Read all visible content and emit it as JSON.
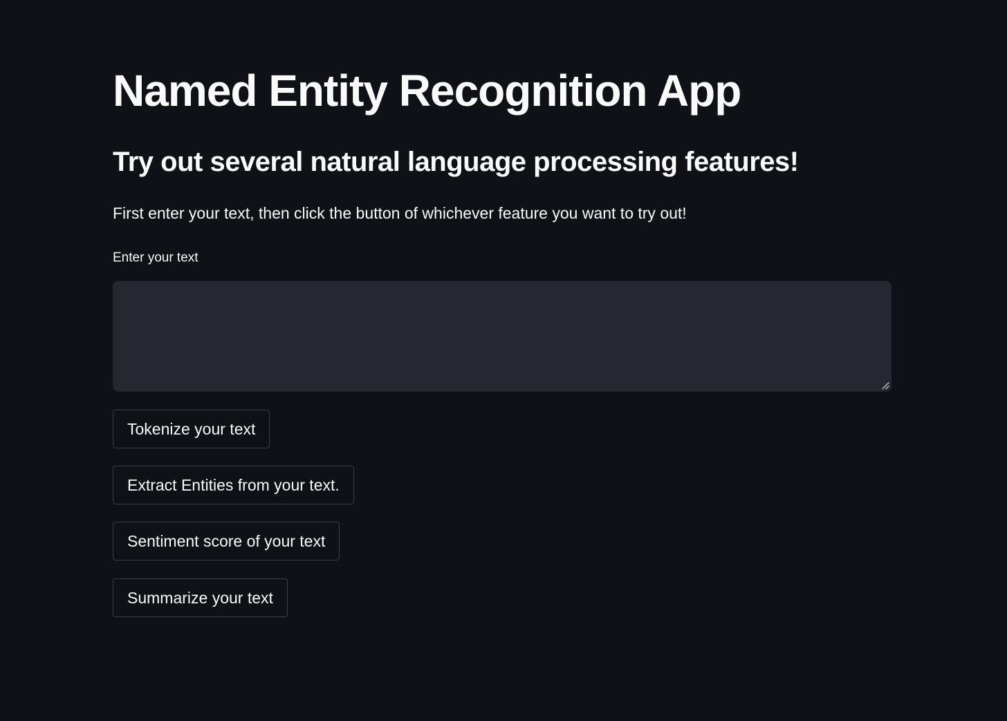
{
  "page": {
    "title": "Named Entity Recognition App",
    "subtitle": "Try out several natural language processing features!",
    "instructions": "First enter your text, then click the button of whichever feature you want to try out!"
  },
  "input": {
    "label": "Enter your text",
    "value": "",
    "placeholder": ""
  },
  "buttons": [
    {
      "label": "Tokenize your text"
    },
    {
      "label": "Extract Entities from your text."
    },
    {
      "label": "Sentiment score of your text"
    },
    {
      "label": "Summarize your text"
    }
  ],
  "colors": {
    "background": "#0f1117",
    "input_background": "#262730",
    "button_border": "#3b3d4a",
    "text": "#fafafa"
  },
  "icons": {
    "resize_grip": "resize-handle-icon"
  }
}
